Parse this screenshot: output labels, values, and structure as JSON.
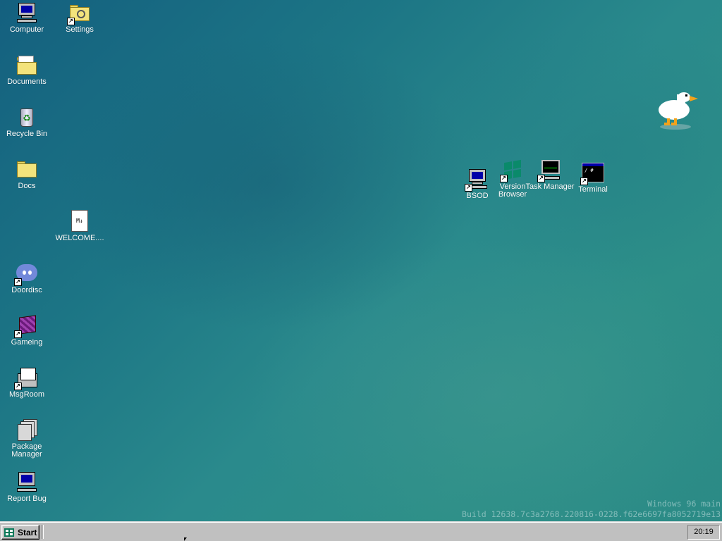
{
  "desktop": {
    "icons": [
      {
        "label": "Computer",
        "icon": "computer-icon",
        "shortcut": false
      },
      {
        "label": "Settings",
        "icon": "settings-icon",
        "shortcut": true
      },
      {
        "label": "Documents",
        "icon": "documents-folder-icon",
        "shortcut": false
      },
      {
        "label": "Recycle Bin",
        "icon": "recycle-bin-icon",
        "shortcut": false
      },
      {
        "label": "Docs",
        "icon": "folder-icon",
        "shortcut": false
      },
      {
        "label": "WELCOME....",
        "icon": "markdown-file-icon",
        "shortcut": false,
        "file_badge": "M↓"
      },
      {
        "label": "Doordisc",
        "icon": "discord-icon",
        "shortcut": true
      },
      {
        "label": "Gameing",
        "icon": "game-cube-icon",
        "shortcut": true
      },
      {
        "label": "MsgRoom",
        "icon": "chat-computer-icon",
        "shortcut": true
      },
      {
        "label": "Package Manager",
        "icon": "package-manager-icon",
        "shortcut": false
      },
      {
        "label": "Report Bug",
        "icon": "report-bug-icon",
        "shortcut": false
      },
      {
        "label": "BSOD",
        "icon": "bsod-computer-icon",
        "shortcut": true
      },
      {
        "label": "Version Browser",
        "icon": "windows-flag-icon",
        "shortcut": true
      },
      {
        "label": "Task Manager",
        "icon": "task-manager-icon",
        "shortcut": true
      },
      {
        "label": "Terminal",
        "icon": "terminal-icon",
        "shortcut": true,
        "prompt": "/ #"
      }
    ],
    "watermark": {
      "line1": "Windows 96 main",
      "line2": "Build 12638.7c3a2768.220816-0228.f62e6697fa8052719e13"
    },
    "goose": "goose-pet-icon"
  },
  "taskbar": {
    "start_label": "Start",
    "clock": "20:19"
  },
  "colors": {
    "desktop_teal": "#2a8a8c",
    "taskbar_gray": "#c0c0c0"
  }
}
